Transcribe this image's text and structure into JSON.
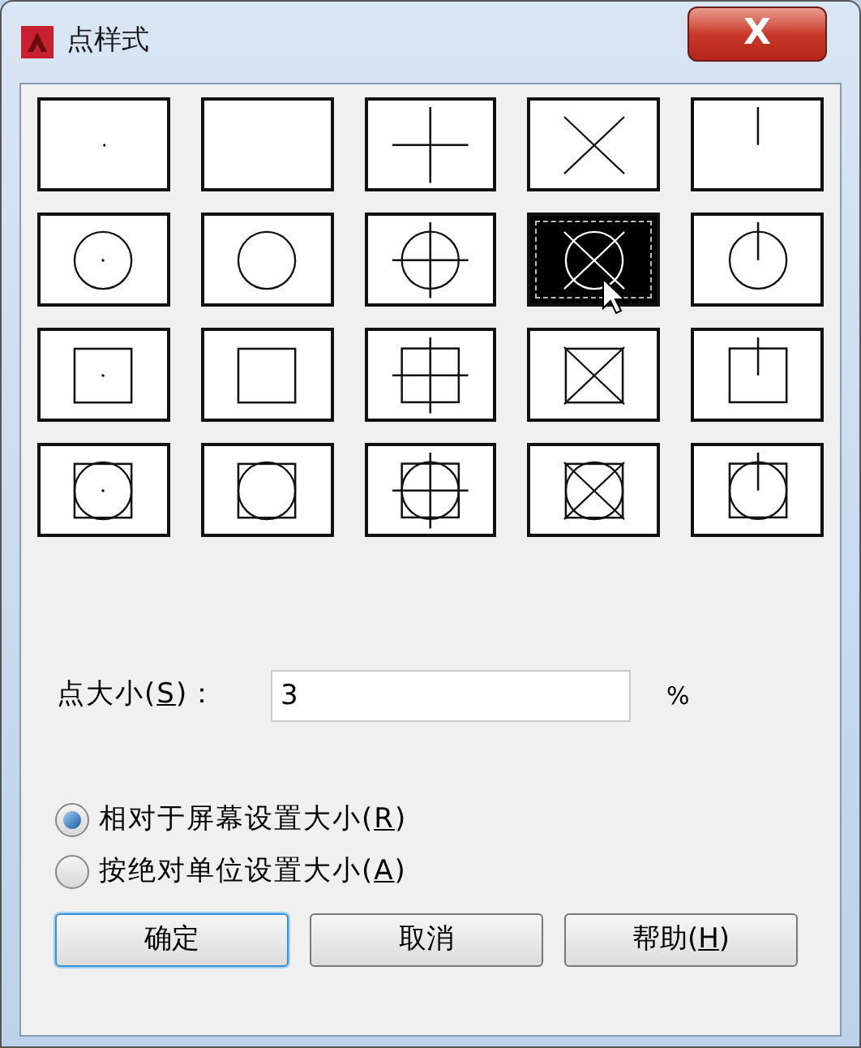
{
  "window": {
    "title": "点样式",
    "close": "X"
  },
  "styles": [
    {
      "kind": "dot",
      "selected": false
    },
    {
      "kind": "none",
      "selected": false
    },
    {
      "kind": "plus",
      "selected": false
    },
    {
      "kind": "cross",
      "selected": false
    },
    {
      "kind": "tick",
      "selected": false
    },
    {
      "kind": "dot",
      "frame": {
        "kind": "circle"
      },
      "selected": false
    },
    {
      "kind": "none",
      "frame": {
        "kind": "circle"
      },
      "selected": false
    },
    {
      "kind": "plus",
      "frame": {
        "kind": "circle"
      },
      "selected": false
    },
    {
      "kind": "cross",
      "frame": {
        "kind": "circle"
      },
      "selected": true
    },
    {
      "kind": "tick",
      "frame": {
        "kind": "circle"
      },
      "selected": false
    },
    {
      "kind": "dot",
      "frame": {
        "kind": "square"
      },
      "selected": false
    },
    {
      "kind": "none",
      "frame": {
        "kind": "square"
      },
      "selected": false
    },
    {
      "kind": "plus",
      "frame": {
        "kind": "square"
      },
      "selected": false
    },
    {
      "kind": "cross",
      "frame": {
        "kind": "square"
      },
      "selected": false
    },
    {
      "kind": "tick",
      "frame": {
        "kind": "square"
      },
      "selected": false
    },
    {
      "kind": "dot",
      "frame": {
        "kind": "both"
      },
      "selected": false
    },
    {
      "kind": "none",
      "frame": {
        "kind": "both"
      },
      "selected": false
    },
    {
      "kind": "plus",
      "frame": {
        "kind": "both"
      },
      "selected": false
    },
    {
      "kind": "cross",
      "frame": {
        "kind": "both"
      },
      "selected": false
    },
    {
      "kind": "tick",
      "frame": {
        "kind": "both"
      },
      "selected": false
    }
  ],
  "size": {
    "label": {
      "before": "点大小(",
      "key": "S",
      "after": ")："
    },
    "value": "3",
    "unit": "%"
  },
  "modes": [
    {
      "label": {
        "before": "相对于屏幕设置大小(",
        "key": "R",
        "after": ")"
      },
      "selected": true
    },
    {
      "label": {
        "before": "按绝对单位设置大小(",
        "key": "A",
        "after": ")"
      },
      "selected": false
    }
  ],
  "buttons": [
    {
      "label": {
        "before": "确定"
      },
      "default": true
    },
    {
      "label": {
        "before": "取消"
      },
      "default": false
    },
    {
      "label": {
        "before": "帮助(",
        "key": "H",
        "after": ")"
      },
      "default": false
    }
  ]
}
